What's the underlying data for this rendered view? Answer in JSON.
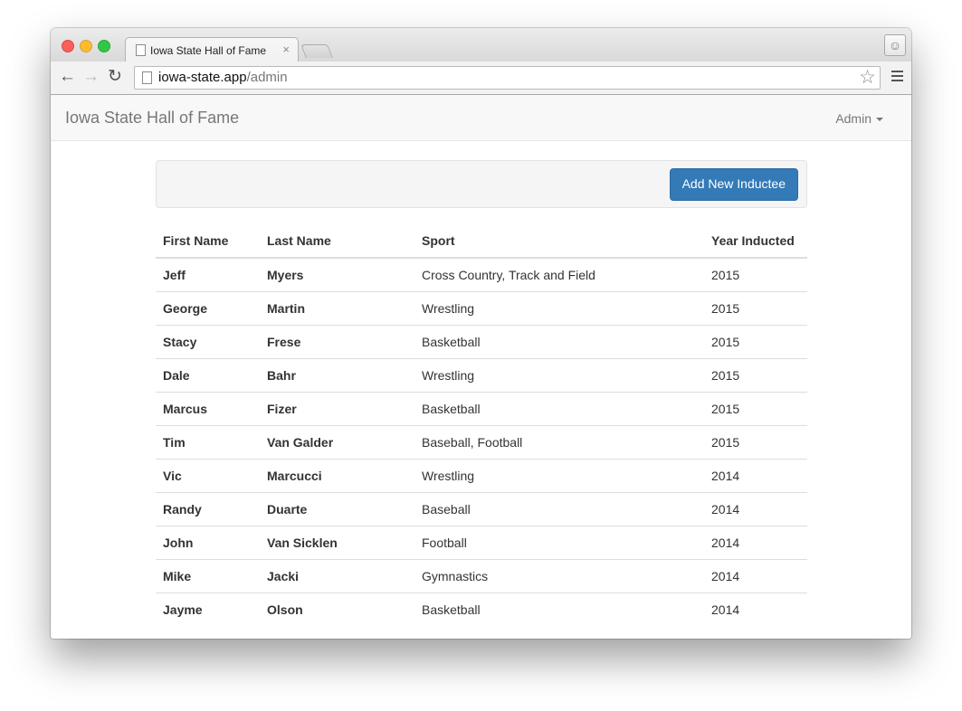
{
  "browser": {
    "tab_title": "Iowa State Hall of Fame",
    "tab_close": "×",
    "url_host": "iowa-state.app",
    "url_path": "/admin",
    "icons": {
      "back": "arrow-left-icon",
      "forward": "arrow-right-icon",
      "reload": "reload-icon",
      "bookmark": "star-icon",
      "menu": "hamburger-menu-icon",
      "profile": "person-icon"
    }
  },
  "navbar": {
    "brand": "Iowa State Hall of Fame",
    "admin_label": "Admin"
  },
  "actions": {
    "add_label": "Add New Inductee",
    "accent": "#337ab7"
  },
  "table": {
    "headers": [
      "First Name",
      "Last Name",
      "Sport",
      "Year Inducted"
    ],
    "rows": [
      [
        "Jeff",
        "Myers",
        "Cross Country, Track and Field",
        "2015"
      ],
      [
        "George",
        "Martin",
        "Wrestling",
        "2015"
      ],
      [
        "Stacy",
        "Frese",
        "Basketball",
        "2015"
      ],
      [
        "Dale",
        "Bahr",
        "Wrestling",
        "2015"
      ],
      [
        "Marcus",
        "Fizer",
        "Basketball",
        "2015"
      ],
      [
        "Tim",
        "Van Galder",
        "Baseball, Football",
        "2015"
      ],
      [
        "Vic",
        "Marcucci",
        "Wrestling",
        "2014"
      ],
      [
        "Randy",
        "Duarte",
        "Baseball",
        "2014"
      ],
      [
        "John",
        "Van Sicklen",
        "Football",
        "2014"
      ],
      [
        "Mike",
        "Jacki",
        "Gymnastics",
        "2014"
      ],
      [
        "Jayme",
        "Olson",
        "Basketball",
        "2014"
      ]
    ]
  }
}
